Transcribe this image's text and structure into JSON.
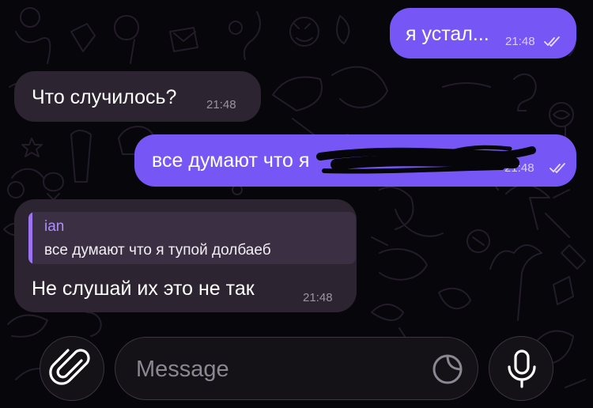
{
  "messages": [
    {
      "direction": "outgoing",
      "text": "я устал...",
      "time": "21:48",
      "status": "read"
    },
    {
      "direction": "incoming",
      "text": "Что случилось?",
      "time": "21:48"
    },
    {
      "direction": "outgoing",
      "text": "все думают что я",
      "time": "21:48",
      "status": "read",
      "redacted": true
    },
    {
      "direction": "incoming",
      "reply_to": {
        "author": "ian",
        "text": "все думают что я тупой долбаеб"
      },
      "text": "Не слушай их это не так",
      "time": "21:48"
    }
  ],
  "composer": {
    "placeholder": "Message",
    "attach_icon": "paperclip-icon",
    "sticker_icon": "sticker-icon",
    "mic_icon": "microphone-icon"
  },
  "colors": {
    "outgoing_bubble": "#7657f6",
    "incoming_bubble": "#2c2430",
    "background": "#07060a",
    "reply_accent": "#9d74f0"
  }
}
